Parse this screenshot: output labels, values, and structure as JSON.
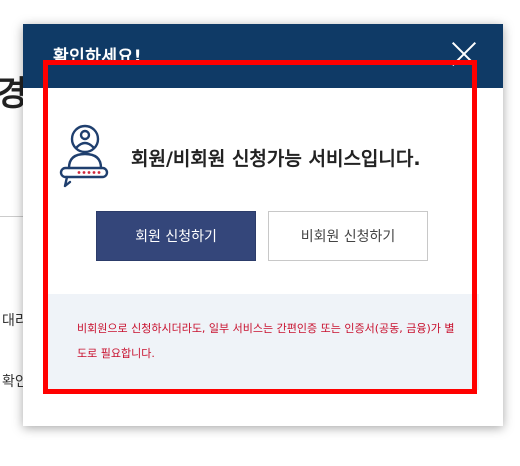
{
  "background_page": {
    "heading_fragment": "경",
    "line1_fragment": "대리",
    "line2_fragment": "확인"
  },
  "modal": {
    "title": "확인하세요!",
    "message": "회원/비회원 신청가능 서비스입니다.",
    "member_button_label": "회원 신청하기",
    "nonmember_button_label": "비회원 신청하기",
    "notice": "비회원으로 신청하시더라도, 일부 서비스는 간편인증 또는 인증서(공동, 금융)가 별도로 필요합니다."
  },
  "colors": {
    "header_bg": "#0f3a66",
    "primary_button": "#34467a",
    "notice_bg": "#eff3f8",
    "notice_text": "#c8102e",
    "highlight": "#ff0000"
  },
  "icons": {
    "close": "close-icon",
    "service": "member-service-icon"
  }
}
